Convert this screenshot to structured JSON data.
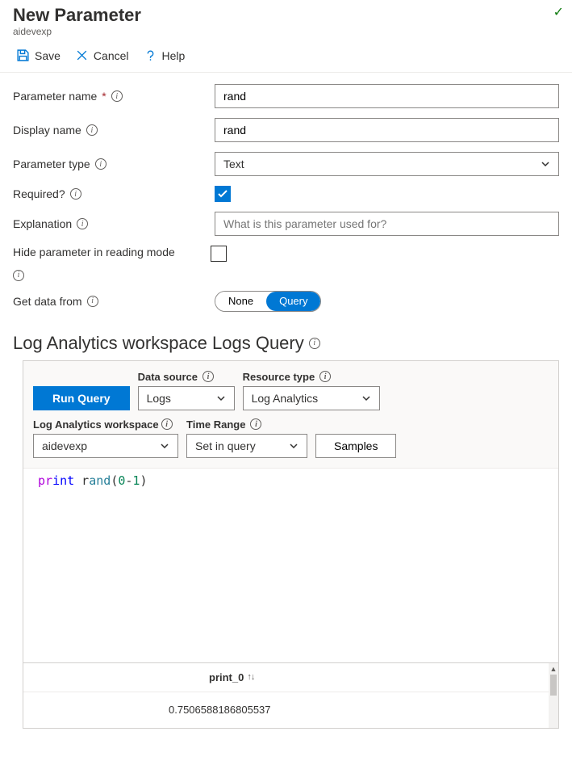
{
  "header": {
    "title": "New Parameter",
    "subtitle": "aidevexp"
  },
  "toolbar": {
    "save": "Save",
    "cancel": "Cancel",
    "help": "Help"
  },
  "form": {
    "param_name_label": "Parameter name",
    "param_name_value": "rand",
    "display_name_label": "Display name",
    "display_name_value": "rand",
    "param_type_label": "Parameter type",
    "param_type_value": "Text",
    "required_label": "Required?",
    "required_checked": true,
    "explanation_label": "Explanation",
    "explanation_placeholder": "What is this parameter used for?",
    "hide_label": "Hide parameter in reading mode",
    "hide_checked": false,
    "get_data_label": "Get data from",
    "get_data_options": {
      "none": "None",
      "query": "Query"
    },
    "get_data_selected": "query"
  },
  "section": {
    "title": "Log Analytics workspace Logs Query"
  },
  "query": {
    "run_label": "Run Query",
    "data_source_label": "Data source",
    "data_source_value": "Logs",
    "resource_type_label": "Resource type",
    "resource_type_value": "Log Analytics",
    "workspace_label": "Log Analytics workspace",
    "workspace_value": "aidevexp",
    "time_range_label": "Time Range",
    "time_range_value": "Set in query",
    "samples_label": "Samples",
    "code": {
      "t1": "pr",
      "t2": "int",
      "t3": " r",
      "t4": "and",
      "t5": "(",
      "t6": "0",
      "t7": "-",
      "t8": "1",
      "t9": ")"
    }
  },
  "results": {
    "column": "print_0",
    "value": "0.7506588186805537"
  }
}
